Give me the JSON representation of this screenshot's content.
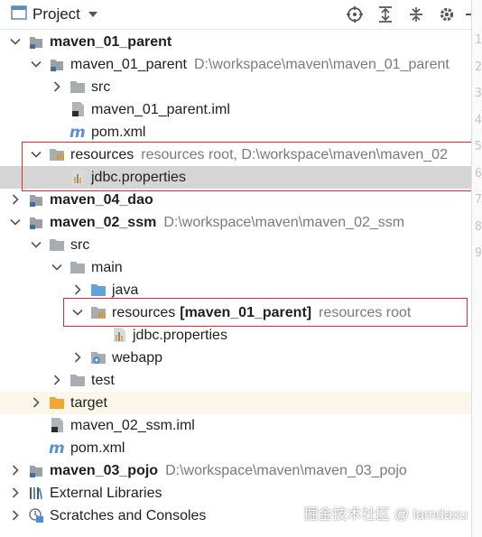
{
  "header": {
    "title": "Project"
  },
  "tree": [
    {
      "label": "maven_01_parent",
      "bold": true,
      "path": "",
      "arrow": "down",
      "icon": "module"
    },
    {
      "label": "maven_01_parent",
      "bold": false,
      "path": "D:\\workspace\\maven\\maven_01_parent",
      "arrow": "down",
      "icon": "module"
    },
    {
      "label": "src",
      "bold": false,
      "path": "",
      "arrow": "right",
      "icon": "folder-gray"
    },
    {
      "label": "maven_01_parent.iml",
      "bold": false,
      "path": "",
      "arrow": "",
      "icon": "iml-file"
    },
    {
      "label": "pom.xml",
      "bold": false,
      "path": "",
      "arrow": "",
      "icon": "maven"
    },
    {
      "label": "resources",
      "bold": false,
      "path": "resources root,  D:\\workspace\\maven\\maven_02",
      "arrow": "down",
      "icon": "folder-resources"
    },
    {
      "label": "jdbc.properties",
      "bold": false,
      "path": "",
      "arrow": "",
      "icon": "properties-file"
    },
    {
      "label": "maven_04_dao",
      "bold": true,
      "path": "",
      "arrow": "right",
      "icon": "module"
    },
    {
      "label": "maven_02_ssm",
      "bold": true,
      "path": "D:\\workspace\\maven\\maven_02_ssm",
      "arrow": "down",
      "icon": "module"
    },
    {
      "label": "src",
      "bold": false,
      "path": "",
      "arrow": "down",
      "icon": "folder-gray"
    },
    {
      "label": "main",
      "bold": false,
      "path": "",
      "arrow": "down",
      "icon": "folder-gray"
    },
    {
      "label": "java",
      "bold": false,
      "path": "",
      "arrow": "right",
      "icon": "folder-blue"
    },
    {
      "label": "resources",
      "bold": false,
      "bold_suffix": "[maven_01_parent]",
      "path": "resources root",
      "arrow": "down",
      "icon": "folder-resources"
    },
    {
      "label": "jdbc.properties",
      "bold": false,
      "path": "",
      "arrow": "",
      "icon": "properties-file"
    },
    {
      "label": "webapp",
      "bold": false,
      "path": "",
      "arrow": "right",
      "icon": "folder-web"
    },
    {
      "label": "test",
      "bold": false,
      "path": "",
      "arrow": "right",
      "icon": "folder-gray"
    },
    {
      "label": "target",
      "bold": false,
      "path": "",
      "arrow": "right",
      "icon": "folder-orange"
    },
    {
      "label": "maven_02_ssm.iml",
      "bold": false,
      "path": "",
      "arrow": "",
      "icon": "iml-file"
    },
    {
      "label": "pom.xml",
      "bold": false,
      "path": "",
      "arrow": "",
      "icon": "maven"
    },
    {
      "label": "maven_03_pojo",
      "bold": true,
      "path": "D:\\workspace\\maven\\maven_03_pojo",
      "arrow": "right",
      "icon": "module"
    },
    {
      "label": "External Libraries",
      "bold": false,
      "path": "",
      "arrow": "right",
      "icon": "libraries"
    },
    {
      "label": "Scratches and Consoles",
      "bold": false,
      "path": "",
      "arrow": "right",
      "icon": "scratches"
    }
  ],
  "gutter_numbers": [
    "1",
    "2",
    "3",
    "4",
    "5",
    "6",
    "7",
    "8",
    "9"
  ],
  "watermark": "掘金技术社区 @ lamdaxu",
  "colors": {
    "highlight_box": "#d9302f",
    "selection": "#d5d5d5"
  }
}
